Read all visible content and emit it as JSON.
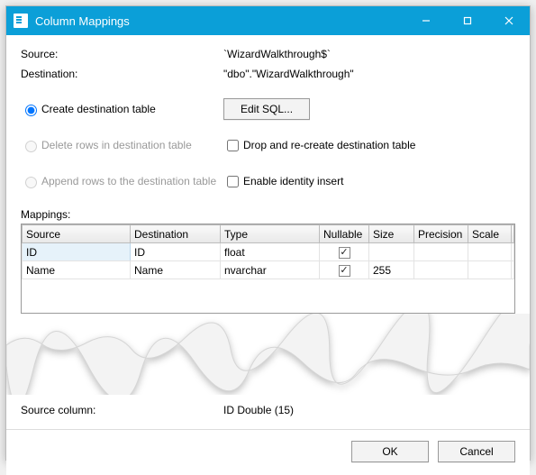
{
  "window": {
    "title": "Column Mappings"
  },
  "fields": {
    "source_label": "Source:",
    "source_value": "`WizardWalkthrough$`",
    "destination_label": "Destination:",
    "destination_value": "\"dbo\".\"WizardWalkthrough\""
  },
  "options": {
    "create_table": "Create destination table",
    "edit_sql": "Edit SQL...",
    "delete_rows": "Delete rows in destination table",
    "drop_recreate": "Drop and re-create destination table",
    "append_rows": "Append rows to the destination table",
    "enable_identity": "Enable identity insert"
  },
  "mappings": {
    "label": "Mappings:",
    "columns": {
      "source": "Source",
      "destination": "Destination",
      "type": "Type",
      "nullable": "Nullable",
      "size": "Size",
      "precision": "Precision",
      "scale": "Scale"
    },
    "rows": [
      {
        "source": "ID",
        "destination": "ID",
        "type": "float",
        "nullable": true,
        "size": "",
        "precision": "",
        "scale": ""
      },
      {
        "source": "Name",
        "destination": "Name",
        "type": "nvarchar",
        "nullable": true,
        "size": "255",
        "precision": "",
        "scale": ""
      }
    ]
  },
  "source_column": {
    "label": "Source column:",
    "value": "ID Double (15)"
  },
  "buttons": {
    "ok": "OK",
    "cancel": "Cancel"
  }
}
